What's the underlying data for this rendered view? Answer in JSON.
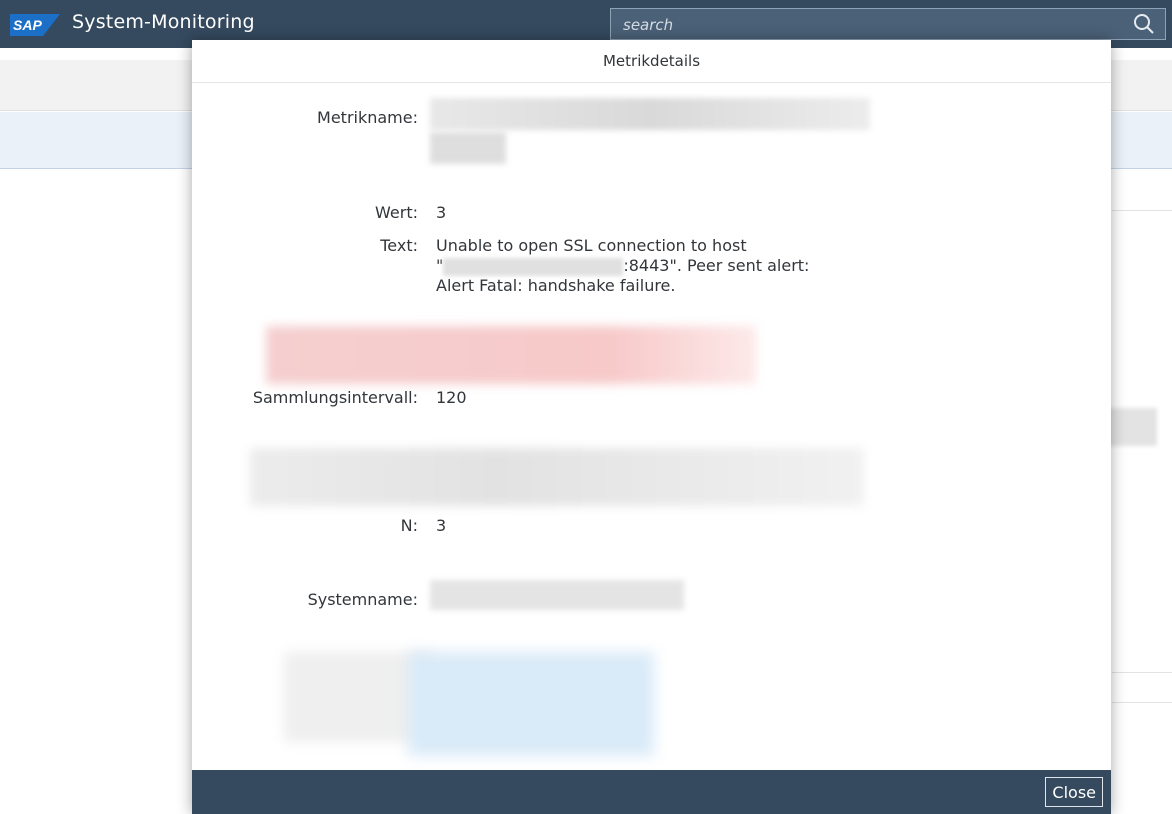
{
  "shell": {
    "logo_text": "SAP",
    "title": "System-Monitoring",
    "search_placeholder": "search",
    "search_icon": "search-icon"
  },
  "dialog": {
    "title": "Metrikdetails",
    "fields": {
      "metric_name_label": "Metrikname:",
      "value_label": "Wert:",
      "value": "3",
      "text_label": "Text:",
      "text_line1": "Unable to open SSL connection to host",
      "text_line2_prefix": "\"",
      "text_line2_suffix": ":8443\". Peer sent alert:",
      "text_line3": "Alert Fatal: handshake failure.",
      "interval_label": "Sammlungsintervall:",
      "interval_value": "120",
      "n_label": "N:",
      "n_value": "3",
      "system_name_label": "Systemname:"
    },
    "close_label": "Close"
  },
  "colors": {
    "shell_bg": "#354a5f",
    "footer_bg": "#354a5f",
    "redaction_red": "#f7c9c9",
    "redaction_blue": "#d6e8f7"
  }
}
